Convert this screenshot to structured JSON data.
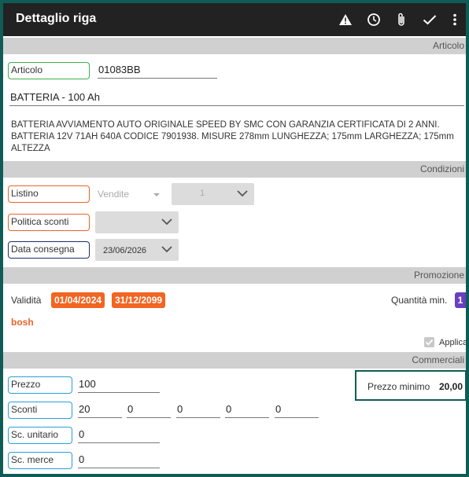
{
  "appbar": {
    "title": "Dettaglio riga",
    "icons": [
      "warning-icon",
      "clock-icon",
      "paperclip-icon",
      "check-icon",
      "more-vert-icon"
    ]
  },
  "sections": {
    "articolo": "Articolo",
    "condizioni": "Condizioni",
    "promozione": "Promozione",
    "commerciali": "Commerciali"
  },
  "articolo": {
    "label": "Articolo",
    "code": "01083BB",
    "name": "BATTERIA - 100 Ah",
    "description": "BATTERIA AVVIAMENTO AUTO ORIGINALE SPEED BY SMC CON GARANZIA CERTIFICATA DI 2 ANNI. BATTERIA 12V 71AH 640A CODICE 7901938. MISURE 278mm LUNGHEZZA; 175mm LARGHEZZA; 175mm ALTEZZA"
  },
  "condizioni": {
    "listino_label": "Listino",
    "listino_value": "Vendite",
    "listino_qty": "1",
    "politica_label": "Politica sconti",
    "politica_value": "",
    "data_label": "Data consegna",
    "data_value": "23/06/2026"
  },
  "promozione": {
    "validita_label": "Validità",
    "date_from": "01/04/2024",
    "date_to": "31/12/2099",
    "qty_min_label": "Quantità min.",
    "qty_min_value": "1",
    "brand": "bosh",
    "applica_label": "Applica",
    "applica_checked": true
  },
  "commerciali": {
    "prezzo_label": "Prezzo",
    "prezzo_value": "100",
    "prezzo_minimo_label": "Prezzo minimo",
    "prezzo_minimo_value": "20,00",
    "sconti_label": "Sconti",
    "sconti_values": [
      "20",
      "0",
      "0",
      "0",
      "0"
    ],
    "sc_unitario_label": "Sc. unitario",
    "sc_unitario_value": "0",
    "sc_merce_label": "Sc. merce",
    "sc_merce_value": "0"
  },
  "colors": {
    "appbar_bg": "#222222",
    "accent_orange": "#f26522",
    "accent_purple": "#6a3fc1",
    "frame_teal": "#0f5c57"
  }
}
